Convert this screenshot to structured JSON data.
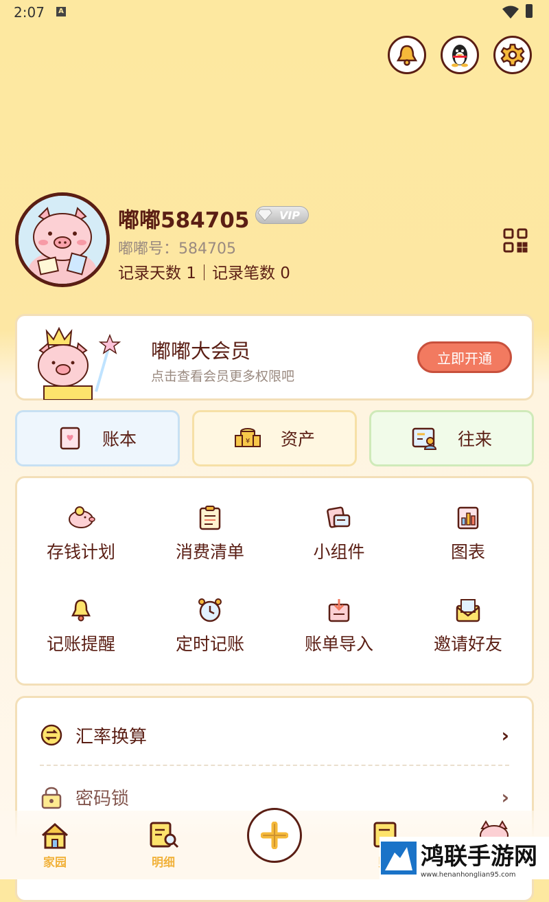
{
  "status_bar": {
    "time": "2:07",
    "a_indicator": "A"
  },
  "header_icons": [
    "bell-icon",
    "qq-penguin-icon",
    "gear-icon"
  ],
  "profile": {
    "username": "嘟嘟584705",
    "vip_badge": "VIP",
    "id_line": "嘟嘟号：584705",
    "stats_line": "记录天数 1｜记录笔数 0"
  },
  "membership": {
    "title": "嘟嘟大会员",
    "subtitle": "点击查看会员更多权限吧",
    "button": "立即开通"
  },
  "quick_tabs": [
    {
      "label": "账本",
      "icon": "ledger-icon",
      "bg": "#eef6fd",
      "border": "#c7e0f3"
    },
    {
      "label": "资产",
      "icon": "coins-icon",
      "bg": "#fff7e1",
      "border": "#f6e0a6"
    },
    {
      "label": "往来",
      "icon": "contact-card-icon",
      "bg": "#f1fbe9",
      "border": "#cfeab9"
    }
  ],
  "tools": [
    {
      "label": "存钱计划",
      "icon": "piggy-bank-icon"
    },
    {
      "label": "消费清单",
      "icon": "checklist-icon"
    },
    {
      "label": "小组件",
      "icon": "widget-icon"
    },
    {
      "label": "图表",
      "icon": "chart-icon"
    },
    {
      "label": "记账提醒",
      "icon": "bell-icon"
    },
    {
      "label": "定时记账",
      "icon": "alarm-clock-icon"
    },
    {
      "label": "账单导入",
      "icon": "import-icon"
    },
    {
      "label": "邀请好友",
      "icon": "invite-letter-icon"
    }
  ],
  "settings": [
    {
      "label": "汇率换算",
      "icon": "exchange-icon"
    },
    {
      "label": "密码锁",
      "icon": "lock-icon"
    }
  ],
  "bottom_nav": [
    {
      "label": "家园",
      "icon": "home-icon"
    },
    {
      "label": "明细",
      "icon": "details-search-icon"
    },
    {
      "label": "",
      "icon": "add-icon"
    },
    {
      "label": "账",
      "icon": "bill-icon"
    },
    {
      "label": "",
      "icon": "pig-profile-icon"
    }
  ],
  "watermark": {
    "text": "鸿联手游网",
    "url": "www.henanhonglian95.com"
  },
  "colors": {
    "primary_text": "#5a1e14",
    "accent": "#f27a60",
    "background_top": "#fde8a0",
    "nav_active": "#f1b23c"
  }
}
